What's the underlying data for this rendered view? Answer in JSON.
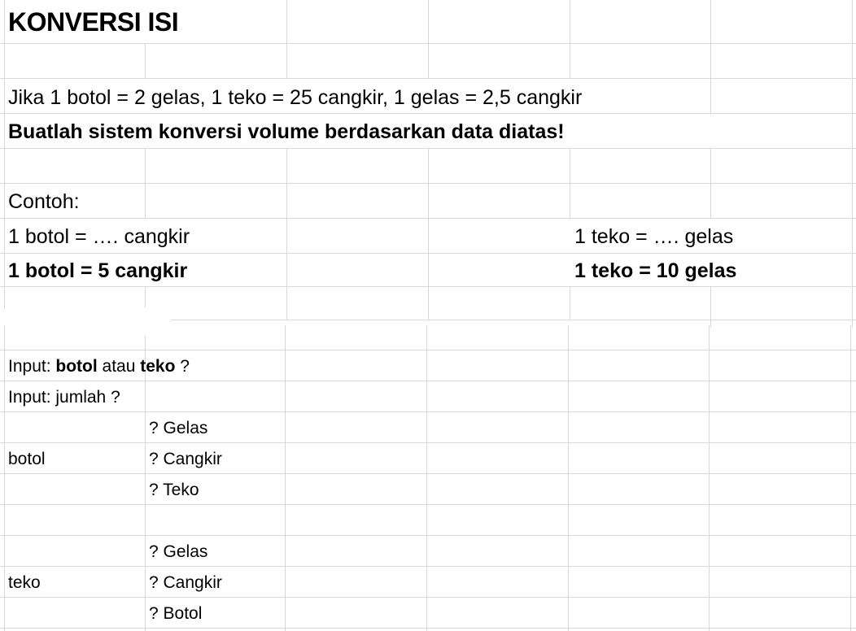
{
  "sheet": {
    "title": "KONVERSI ISI",
    "given": "Jika 1 botol = 2 gelas, 1 teko = 25 cangkir, 1 gelas = 2,5 cangkir",
    "task": "Buatlah sistem konversi volume berdasarkan data diatas!",
    "example_label": "Contoh:",
    "q_botol": "1 botol = …. cangkir",
    "a_botol": "1 botol = 5 cangkir",
    "q_teko": "1 teko = …. gelas",
    "a_teko": "1 teko = 10 gelas",
    "input1": {
      "prefix": "Input: ",
      "opt1": "botol",
      "mid": " atau ",
      "opt2": "teko",
      "suffix": " ?"
    },
    "input2": "Input: jumlah ?",
    "botol_section": {
      "label": "botol",
      "outputs": [
        "? Gelas",
        "? Cangkir",
        "? Teko"
      ]
    },
    "teko_section": {
      "label": "teko",
      "outputs": [
        "? Gelas",
        "? Cangkir",
        "? Botol"
      ]
    }
  }
}
